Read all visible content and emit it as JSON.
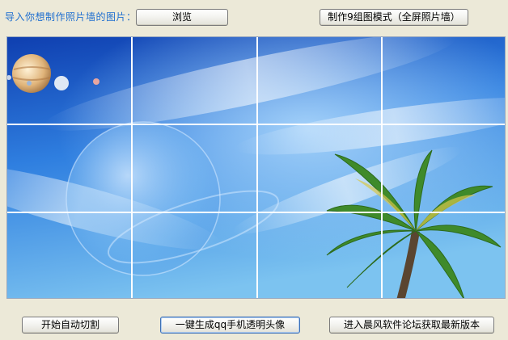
{
  "prompt_label": "导入你想制作照片墙的图片：",
  "buttons": {
    "browse": "浏览",
    "make_wall": "制作9组图模式（全屏照片墙）",
    "auto_cut": "开始自动切割",
    "make_avatar": "一键生成qq手机透明头像",
    "forum": "进入晨风软件论坛获取最新版本"
  },
  "grid": {
    "rows": 3,
    "columns": 4
  },
  "colors": {
    "label_blue": "#1f6fd0",
    "window_bg": "#ece9d8",
    "grid_line": "#ffffff",
    "sky_deep": "#1b56c8",
    "sky_light": "#7cc3f0"
  },
  "icons": {
    "image": "sky-planets-palm-image"
  }
}
